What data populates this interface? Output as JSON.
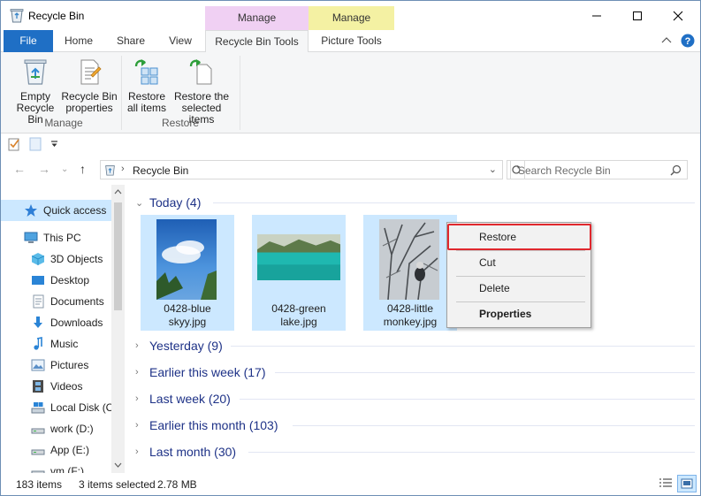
{
  "window": {
    "title": "Recycle Bin"
  },
  "context_tabs": {
    "manage1": "Manage",
    "manage2": "Manage"
  },
  "tabs": {
    "file": "File",
    "home": "Home",
    "share": "Share",
    "view": "View",
    "recycle_bin_tools": "Recycle Bin Tools",
    "picture_tools": "Picture Tools"
  },
  "ribbon": {
    "empty": "Empty\nRecycle Bin",
    "properties": "Recycle Bin\nproperties",
    "restore_all": "Restore\nall items",
    "restore_selected": "Restore the\nselected items",
    "group_manage": "Manage",
    "group_restore": "Restore"
  },
  "address": {
    "location": "Recycle Bin",
    "search_placeholder": "Search Recycle Bin"
  },
  "nav": {
    "quick_access": "Quick access",
    "this_pc": "This PC",
    "objects3d": "3D Objects",
    "desktop": "Desktop",
    "documents": "Documents",
    "downloads": "Downloads",
    "music": "Music",
    "pictures": "Pictures",
    "videos": "Videos",
    "local_disk": "Local Disk (C",
    "work": "work (D:)",
    "app": "App (E:)",
    "vm": "vm (F:)"
  },
  "groups": {
    "today": "Today (4)",
    "yesterday": "Yesterday (9)",
    "earlier_week": "Earlier this week (17)",
    "last_week": "Last week (20)",
    "earlier_month": "Earlier this month (103)",
    "last_month": "Last month (30)"
  },
  "files": [
    {
      "line1": "0428-blue",
      "line2": "skyy.jpg"
    },
    {
      "line1": "0428-green",
      "line2": "lake.jpg"
    },
    {
      "line1": "0428-little",
      "line2": "monkey.jpg"
    }
  ],
  "context_menu": {
    "restore": "Restore",
    "cut": "Cut",
    "delete": "Delete",
    "properties": "Properties"
  },
  "status": {
    "count": "183 items",
    "selected": "3 items selected",
    "size": "2.78 MB"
  },
  "colors": {
    "accent": "#1f6fc5",
    "highlight": "#e0282e",
    "selection": "#cce8ff",
    "group_text": "#1e3287"
  }
}
